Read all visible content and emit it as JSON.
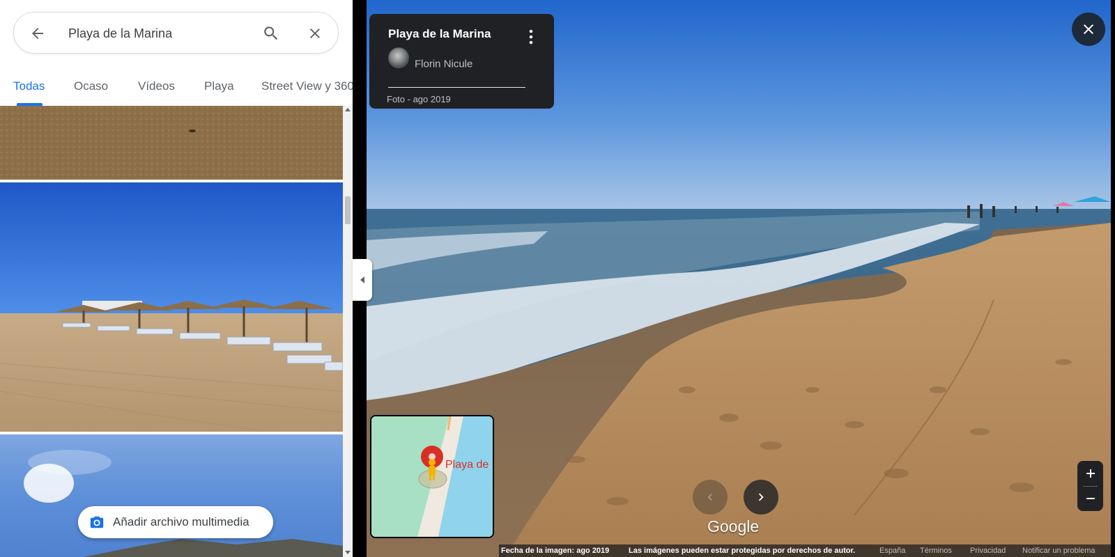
{
  "search": {
    "value": "Playa de la Marina"
  },
  "tabs": [
    {
      "label": "Todas",
      "active": true
    },
    {
      "label": "Ocaso",
      "active": false
    },
    {
      "label": "Vídeos",
      "active": false
    },
    {
      "label": "Playa",
      "active": false
    },
    {
      "label": "Street View y 360°",
      "active": false
    }
  ],
  "gallery": {
    "add_media_label": "Añadir archivo multimedia"
  },
  "photo_card": {
    "title": "Playa de la Marina",
    "author": "Florin Nicule",
    "meta": "Foto - ago 2019"
  },
  "minimap": {
    "label": "Playa de"
  },
  "branding": {
    "logo_text": "Google"
  },
  "footer": {
    "date": "Fecha de la imagen: ago 2019",
    "copyright": "Las imágenes pueden estar protegidas por derechos de autor.",
    "region": "España",
    "terms": "Términos",
    "privacy": "Privacidad",
    "report": "Notificar un problema"
  },
  "icons": {
    "back": "arrow-back-icon",
    "search": "search-icon",
    "clear": "close-icon",
    "camera": "camera-icon",
    "more": "more-vert-icon",
    "pegman": "pegman-icon",
    "prev": "chevron-left-icon",
    "next": "chevron-right-icon",
    "zoom_in": "plus-icon",
    "zoom_out": "minus-icon"
  },
  "colors": {
    "accent": "#1a73e8",
    "card_bg": "#202124",
    "pin": "#d93025"
  }
}
